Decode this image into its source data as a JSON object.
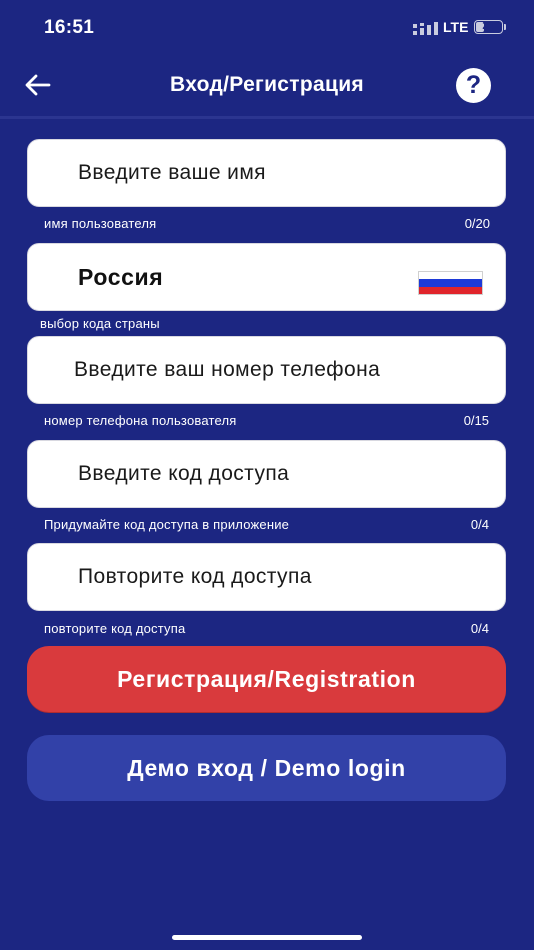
{
  "status_bar": {
    "time": "16:51",
    "network": "LTE",
    "battery_level": "29"
  },
  "header": {
    "title": "Вход/Регистрация",
    "back_icon": "arrow-left-icon",
    "help_icon": "question-circle-icon",
    "help_glyph": "?"
  },
  "form": {
    "name": {
      "placeholder": "Введите ваше имя",
      "helper": "имя пользователя",
      "counter": "0/20"
    },
    "country": {
      "value": "Россия",
      "helper": "выбор кода страны",
      "flag_colors": [
        "#ffffff",
        "#1d3ad8",
        "#e0242b"
      ]
    },
    "phone": {
      "placeholder": "Введите ваш номер телефона",
      "helper": "номер телефона пользователя",
      "counter": "0/15"
    },
    "access_code": {
      "placeholder": "Введите код доступа",
      "helper": "Придумайте код доступа в приложение",
      "counter": "0/4"
    },
    "repeat_code": {
      "placeholder": "Повторите код доступа",
      "helper": "повторите код доступа",
      "counter": "0/4"
    }
  },
  "buttons": {
    "register_label": "Регистрация/Registration",
    "demo_label": "Демо вход / Demo login"
  },
  "colors": {
    "background": "#1c2682",
    "register_button": "#d93a3d",
    "demo_button": "#3241a8"
  }
}
